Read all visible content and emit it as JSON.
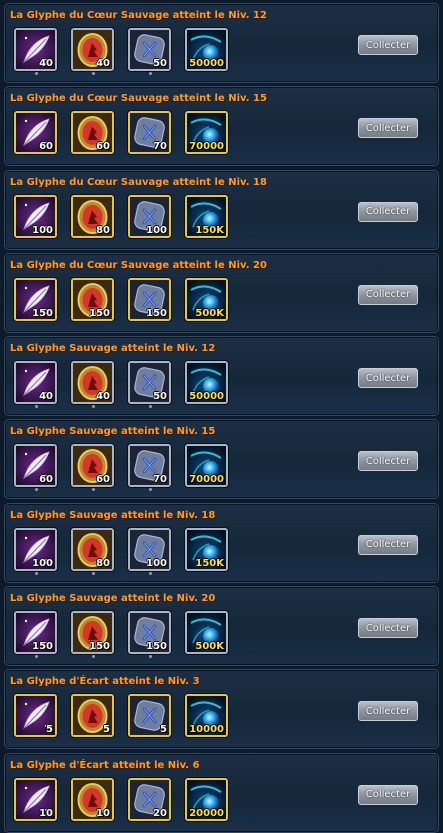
{
  "rows": [
    {
      "title": "La Glyphe du Cœur Sauvage atteint le Niv. 12",
      "frame": "silver",
      "items": [
        {
          "icon": "feather-icon",
          "qty": "40"
        },
        {
          "icon": "emblem-icon",
          "qty": "40"
        },
        {
          "icon": "rune-stone-icon",
          "qty": "50"
        },
        {
          "icon": "blue-orb-icon",
          "qty": "50000"
        }
      ],
      "button": "Collecter"
    },
    {
      "title": "La Glyphe du Cœur Sauvage atteint le Niv. 15",
      "frame": "gold",
      "items": [
        {
          "icon": "feather-icon",
          "qty": "60"
        },
        {
          "icon": "emblem-icon",
          "qty": "60"
        },
        {
          "icon": "rune-stone-icon",
          "qty": "70"
        },
        {
          "icon": "blue-orb-icon",
          "qty": "70000"
        }
      ],
      "button": "Collecter"
    },
    {
      "title": "La Glyphe du Cœur Sauvage atteint le Niv. 18",
      "frame": "gold",
      "items": [
        {
          "icon": "feather-icon",
          "qty": "100"
        },
        {
          "icon": "emblem-icon",
          "qty": "80"
        },
        {
          "icon": "rune-stone-icon",
          "qty": "100"
        },
        {
          "icon": "blue-orb-icon",
          "qty": "150K"
        }
      ],
      "button": "Collecter"
    },
    {
      "title": "La Glyphe du Cœur Sauvage atteint le Niv. 20",
      "frame": "gold",
      "items": [
        {
          "icon": "feather-icon",
          "qty": "150"
        },
        {
          "icon": "emblem-icon",
          "qty": "150"
        },
        {
          "icon": "rune-stone-icon",
          "qty": "150"
        },
        {
          "icon": "blue-orb-icon",
          "qty": "500K"
        }
      ],
      "button": "Collecter"
    },
    {
      "title": "La Glyphe Sauvage atteint le Niv. 12",
      "frame": "silver",
      "items": [
        {
          "icon": "feather-icon",
          "qty": "40"
        },
        {
          "icon": "emblem-icon",
          "qty": "40"
        },
        {
          "icon": "rune-stone-icon",
          "qty": "50"
        },
        {
          "icon": "blue-orb-icon",
          "qty": "50000"
        }
      ],
      "button": "Collecter"
    },
    {
      "title": "La Glyphe Sauvage atteint le Niv. 15",
      "frame": "silver",
      "items": [
        {
          "icon": "feather-icon",
          "qty": "60"
        },
        {
          "icon": "emblem-icon",
          "qty": "60"
        },
        {
          "icon": "rune-stone-icon",
          "qty": "70"
        },
        {
          "icon": "blue-orb-icon",
          "qty": "70000"
        }
      ],
      "button": "Collecter"
    },
    {
      "title": "La Glyphe Sauvage atteint le Niv. 18",
      "frame": "silver",
      "items": [
        {
          "icon": "feather-icon",
          "qty": "100"
        },
        {
          "icon": "emblem-icon",
          "qty": "80"
        },
        {
          "icon": "rune-stone-icon",
          "qty": "100"
        },
        {
          "icon": "blue-orb-icon",
          "qty": "150K"
        }
      ],
      "button": "Collecter"
    },
    {
      "title": "La Glyphe Sauvage atteint le Niv. 20",
      "frame": "silver",
      "items": [
        {
          "icon": "feather-icon",
          "qty": "150"
        },
        {
          "icon": "emblem-icon",
          "qty": "150"
        },
        {
          "icon": "rune-stone-icon",
          "qty": "150"
        },
        {
          "icon": "blue-orb-icon",
          "qty": "500K"
        }
      ],
      "button": "Collecter"
    },
    {
      "title": "La Glyphe d'Écart atteint le Niv. 3",
      "frame": "gold",
      "items": [
        {
          "icon": "feather-icon",
          "qty": "5"
        },
        {
          "icon": "emblem-icon",
          "qty": "5"
        },
        {
          "icon": "rune-stone-icon",
          "qty": "5"
        },
        {
          "icon": "blue-orb-icon",
          "qty": "10000"
        }
      ],
      "button": "Collecter"
    },
    {
      "title": "La Glyphe d'Écart atteint le Niv. 6",
      "frame": "gold",
      "items": [
        {
          "icon": "feather-icon",
          "qty": "10"
        },
        {
          "icon": "emblem-icon",
          "qty": "10"
        },
        {
          "icon": "rune-stone-icon",
          "qty": "20"
        },
        {
          "icon": "blue-orb-icon",
          "qty": "20000"
        }
      ],
      "button": "Collecter"
    }
  ],
  "colors": {
    "title": "#ff9a2a",
    "gold_frame": "#e8c53a",
    "silver_frame": "#aab4c2",
    "qty_gold": "#ffe04a"
  }
}
